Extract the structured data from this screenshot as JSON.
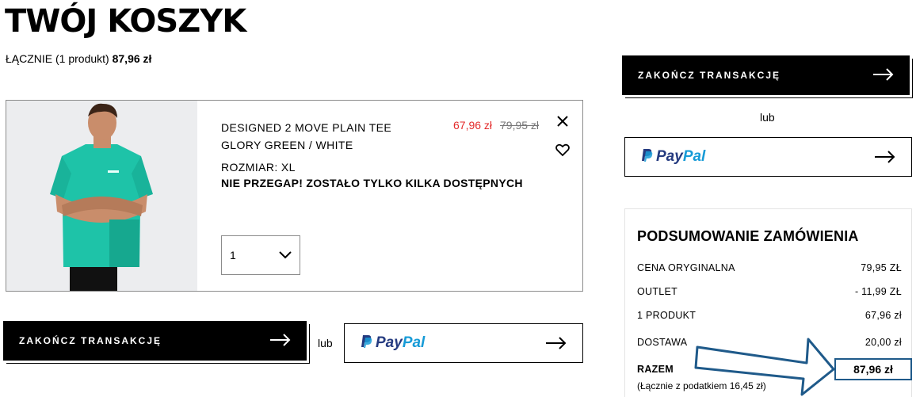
{
  "header": {
    "title": "TWÓJ KOSZYK",
    "summary_prefix": "ŁĄCZNIE (1 produkt)",
    "summary_total": "87,96 zł"
  },
  "product": {
    "name_line1": "DESIGNED 2 MOVE PLAIN TEE",
    "name_line2": "GLORY GREEN / WHITE",
    "price_sale": "67,96 zł",
    "price_old": "79,95 zł",
    "size": "ROZMIAR: XL",
    "stock_warning": "NIE PRZEGAP! ZOSTAŁO TYLKO KILKA DOSTĘPNYCH",
    "quantity": "1"
  },
  "actions": {
    "checkout_label": "ZAKOŃCZ TRANSAKCJĘ",
    "or_label": "lub",
    "paypal_pay": "Pay",
    "paypal_pal": "Pal"
  },
  "order_summary": {
    "title": "PODSUMOWANIE ZAMÓWIENIA",
    "rows": [
      {
        "label": "CENA ORYGINALNA",
        "value": "79,95 ZŁ"
      },
      {
        "label": "OUTLET",
        "value": "- 11,99 ZŁ"
      },
      {
        "label": "1 PRODUKT",
        "value": "67,96 zł"
      },
      {
        "label": "DOSTAWA",
        "value": "20,00 zł"
      }
    ],
    "total_label": "RAZEM",
    "total_value": "87,96 zł",
    "tax_note": "(Łącznie z podatkiem  16,45 zł)"
  },
  "colors": {
    "sale_red": "#e32b2b",
    "paypal_dark": "#253b80",
    "paypal_light": "#179bd7",
    "annotation_blue": "#1f5a8a",
    "shirt_green": "#1ec3a8"
  },
  "icons": [
    "close-icon",
    "heart-icon",
    "chevron-down-icon",
    "arrow-right-icon",
    "paypal-logo-icon"
  ]
}
